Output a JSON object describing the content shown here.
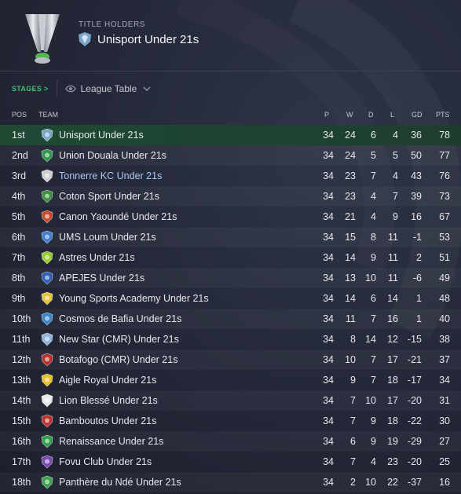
{
  "header": {
    "subtitle": "TITLE HOLDERS",
    "holder_name": "Unisport Under 21s"
  },
  "stages": {
    "label": "STAGES >",
    "selected": "League Table"
  },
  "columns": {
    "pos": "POS",
    "team": "TEAM",
    "p": "P",
    "w": "W",
    "d": "D",
    "l": "L",
    "gd": "GD",
    "pts": "PTS"
  },
  "rows": [
    {
      "pos": "1st",
      "team": "Unisport Under 21s",
      "p": "34",
      "w": "24",
      "d": "6",
      "l": "4",
      "gd": "36",
      "pts": "78",
      "badge_color": "#7aa7c9",
      "badge_icon": "unisport-crest"
    },
    {
      "pos": "2nd",
      "team": "Union Douala Under 21s",
      "p": "34",
      "w": "24",
      "d": "5",
      "l": "5",
      "gd": "50",
      "pts": "77",
      "badge_color": "#2e9a48",
      "badge_icon": "union-douala-crest"
    },
    {
      "pos": "3rd",
      "team": "Tonnerre KC Under 21s",
      "p": "34",
      "w": "23",
      "d": "7",
      "l": "4",
      "gd": "43",
      "pts": "76",
      "badge_color": "#cfcfcf",
      "badge_icon": "tonnerre-crest"
    },
    {
      "pos": "4th",
      "team": "Coton Sport Under 21s",
      "p": "34",
      "w": "23",
      "d": "4",
      "l": "7",
      "gd": "39",
      "pts": "73",
      "badge_color": "#3a8f3e",
      "badge_icon": "coton-sport-crest"
    },
    {
      "pos": "5th",
      "team": "Canon Yaoundé Under 21s",
      "p": "34",
      "w": "21",
      "d": "4",
      "l": "9",
      "gd": "16",
      "pts": "67",
      "badge_color": "#c94a2a",
      "badge_icon": "canon-crest"
    },
    {
      "pos": "6th",
      "team": "UMS Loum Under 21s",
      "p": "34",
      "w": "15",
      "d": "8",
      "l": "11",
      "gd": "-1",
      "pts": "53",
      "badge_color": "#3f7fd1",
      "badge_icon": "ums-loum-crest"
    },
    {
      "pos": "7th",
      "team": "Astres Under 21s",
      "p": "34",
      "w": "14",
      "d": "9",
      "l": "11",
      "gd": "2",
      "pts": "51",
      "badge_color": "#9acb2f",
      "badge_icon": "astres-crest"
    },
    {
      "pos": "8th",
      "team": "APEJES Under 21s",
      "p": "34",
      "w": "13",
      "d": "10",
      "l": "11",
      "gd": "-6",
      "pts": "49",
      "badge_color": "#2c5fb8",
      "badge_icon": "apejes-crest"
    },
    {
      "pos": "9th",
      "team": "Young Sports Academy Under 21s",
      "p": "34",
      "w": "14",
      "d": "6",
      "l": "14",
      "gd": "1",
      "pts": "48",
      "badge_color": "#e6c13a",
      "badge_icon": "ysa-crest"
    },
    {
      "pos": "10th",
      "team": "Cosmos de Bafia Under 21s",
      "p": "34",
      "w": "11",
      "d": "7",
      "l": "16",
      "gd": "1",
      "pts": "40",
      "badge_color": "#3b86c8",
      "badge_icon": "cosmos-crest"
    },
    {
      "pos": "11th",
      "team": "New Star (CMR) Under 21s",
      "p": "34",
      "w": "8",
      "d": "14",
      "l": "12",
      "gd": "-15",
      "pts": "38",
      "badge_color": "#8fb3d9",
      "badge_icon": "new-star-crest"
    },
    {
      "pos": "12th",
      "team": "Botafogo (CMR) Under 21s",
      "p": "34",
      "w": "10",
      "d": "7",
      "l": "17",
      "gd": "-21",
      "pts": "37",
      "badge_color": "#b8302a",
      "badge_icon": "botafogo-crest"
    },
    {
      "pos": "13th",
      "team": "Aigle Royal Under 21s",
      "p": "34",
      "w": "9",
      "d": "7",
      "l": "18",
      "gd": "-17",
      "pts": "34",
      "badge_color": "#e5c02c",
      "badge_icon": "aigle-royal-crest"
    },
    {
      "pos": "14th",
      "team": "Lion Blessé Under 21s",
      "p": "34",
      "w": "7",
      "d": "10",
      "l": "17",
      "gd": "-20",
      "pts": "31",
      "badge_color": "#e8e8e8",
      "badge_icon": "lion-blesse-crest"
    },
    {
      "pos": "15th",
      "team": "Bamboutos Under 21s",
      "p": "34",
      "w": "7",
      "d": "9",
      "l": "18",
      "gd": "-22",
      "pts": "30",
      "badge_color": "#c0302e",
      "badge_icon": "bamboutos-crest"
    },
    {
      "pos": "16th",
      "team": "Renaissance Under 21s",
      "p": "34",
      "w": "6",
      "d": "9",
      "l": "19",
      "gd": "-29",
      "pts": "27",
      "badge_color": "#2fa04a",
      "badge_icon": "renaissance-crest"
    },
    {
      "pos": "17th",
      "team": "Fovu Club Under 21s",
      "p": "34",
      "w": "7",
      "d": "4",
      "l": "23",
      "gd": "-20",
      "pts": "25",
      "badge_color": "#7a4bb0",
      "badge_icon": "fovu-crest"
    },
    {
      "pos": "18th",
      "team": "Panthère du Ndé Under 21s",
      "p": "34",
      "w": "2",
      "d": "10",
      "l": "22",
      "gd": "-37",
      "pts": "16",
      "badge_color": "#3da24e",
      "badge_icon": "panthere-crest"
    }
  ],
  "colors": {
    "accent_green": "#3fbf74",
    "link_blue": "#a9c8f5",
    "leader_row": "#1f4a34"
  }
}
